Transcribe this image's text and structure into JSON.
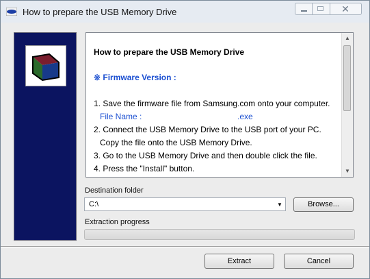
{
  "window": {
    "title": "How to prepare the USB Memory Drive"
  },
  "info": {
    "heading": "How to prepare the USB Memory Drive",
    "firmware_label": "※ Firmware Version :",
    "steps": [
      "1. Save the firmware file from Samsung.com onto your computer.",
      "File Name :",
      ".exe",
      "2. Connect the USB Memory Drive to the USB port of your PC.",
      "Copy the file onto the USB Memory Drive.",
      "3. Go to the USB Memory Drive and then double click the file.",
      "4. Press the \"Install\" button."
    ]
  },
  "destination": {
    "label": "Destination folder",
    "value": "C:\\"
  },
  "browse_label": "Browse...",
  "progress": {
    "label": "Extraction progress",
    "percent": 0
  },
  "buttons": {
    "extract": "Extract",
    "cancel": "Cancel"
  },
  "colors": {
    "banner": "#0b1460",
    "link_blue": "#1b4fd1"
  }
}
